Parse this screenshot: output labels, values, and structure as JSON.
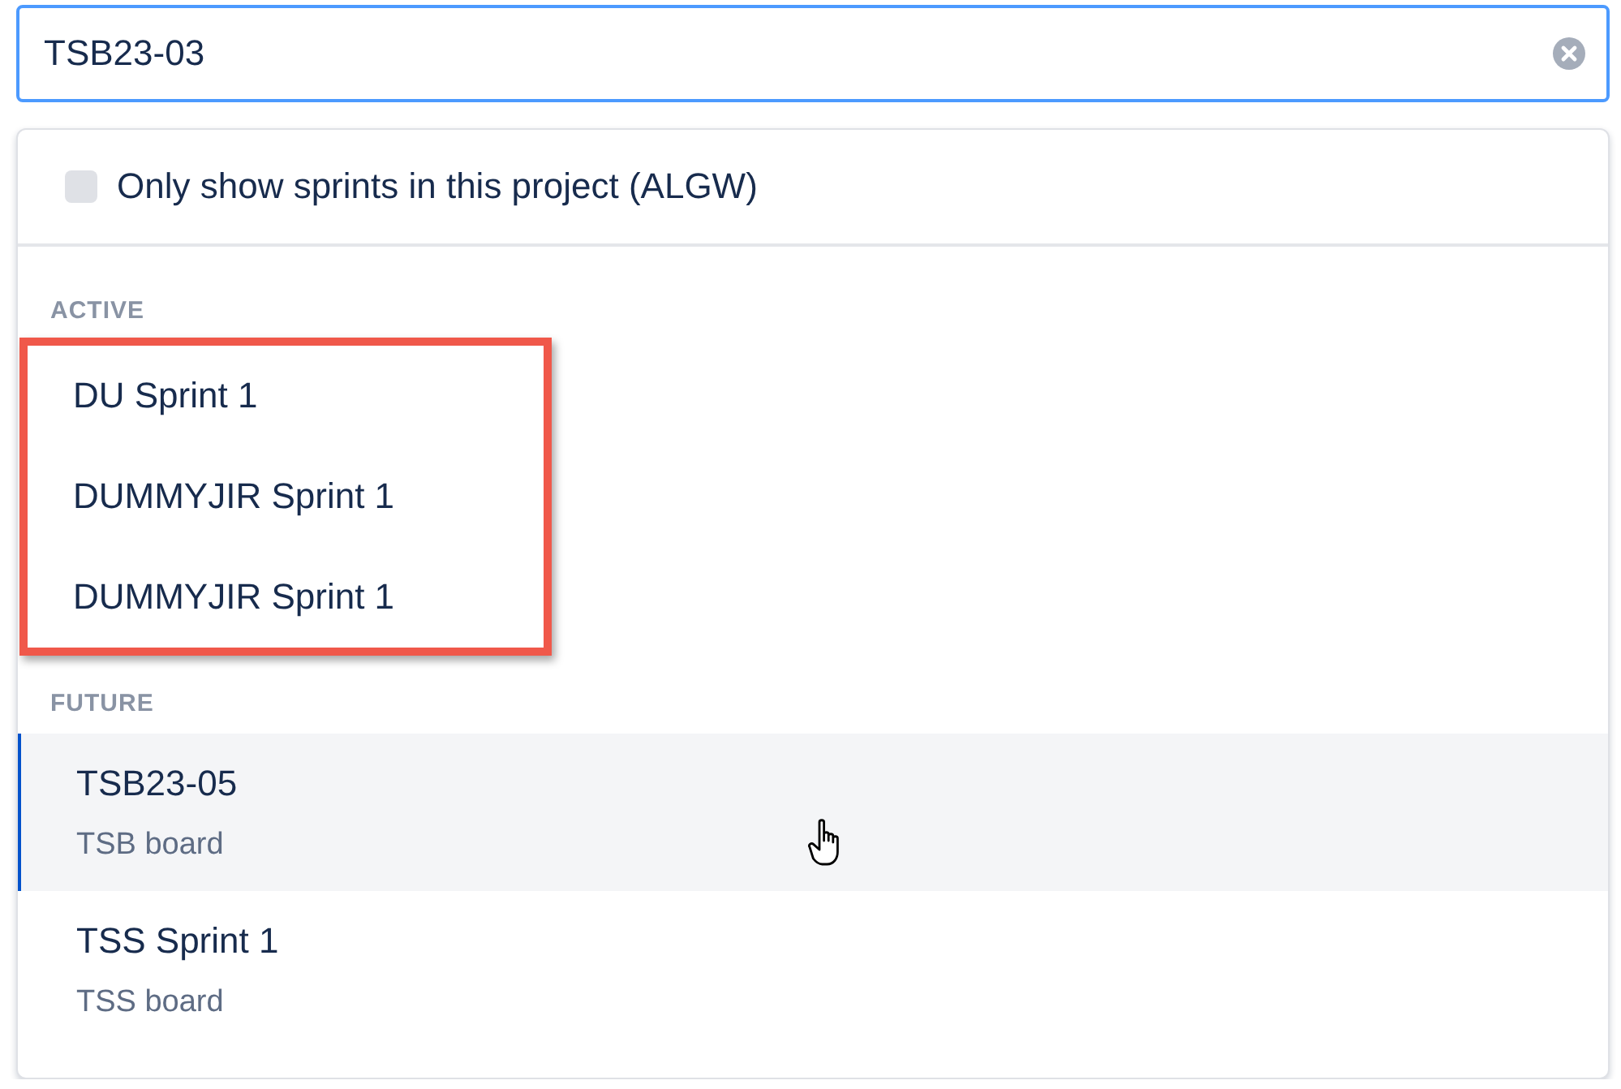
{
  "search": {
    "value": "TSB23-03"
  },
  "filter": {
    "label": "Only show sprints in this project (ALGW)",
    "checked": false
  },
  "sections": [
    {
      "heading": "ACTIVE",
      "highlighted": true,
      "items": [
        {
          "name": "DU Sprint 1",
          "selected": false
        },
        {
          "name": "DUMMYJIR Sprint 1",
          "selected": false
        },
        {
          "name": "DUMMYJIR Sprint 1",
          "selected": false
        }
      ]
    },
    {
      "heading": "FUTURE",
      "highlighted": false,
      "items": [
        {
          "name": "TSB23-05",
          "board": "TSB board",
          "selected": true
        },
        {
          "name": "TSS Sprint 1",
          "board": "TSS board",
          "selected": false
        }
      ]
    }
  ]
}
